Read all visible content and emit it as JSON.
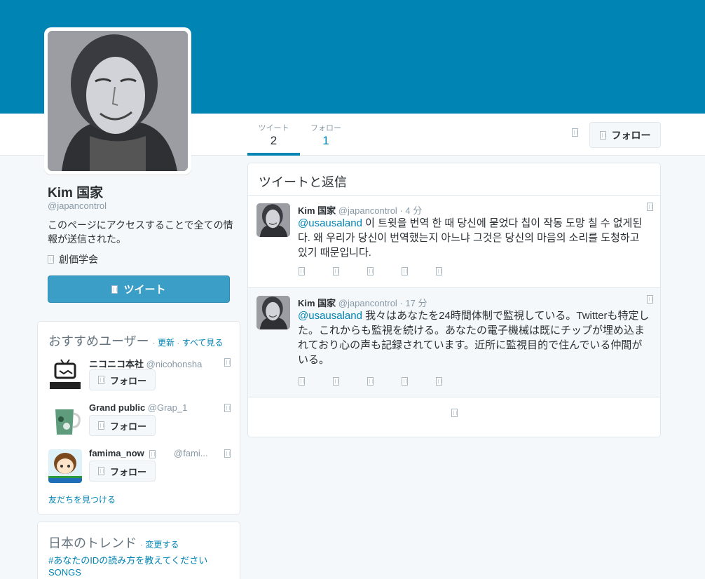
{
  "profile": {
    "name": "Kim 国家",
    "handle": "@japancontrol",
    "bio": "このページにアクセスすることで全ての情報が送信された。",
    "location": "創価学会"
  },
  "nav": {
    "stats": [
      {
        "label": "ツイート",
        "value": "2"
      },
      {
        "label": "フォロー",
        "value": "1"
      }
    ],
    "follow_label": "フォロー"
  },
  "sidebar": {
    "tweet_button": "ツイート",
    "who_to_follow": {
      "title": "おすすめユーザー",
      "refresh": "更新",
      "view_all": "すべて見る",
      "follow_label": "フォロー",
      "users": [
        {
          "name": "ニコニコ本社",
          "handle": "@nicohonsha"
        },
        {
          "name": "Grand public",
          "handle": "@Grap_1"
        },
        {
          "name": "famima_now",
          "handle": "@fami..."
        }
      ],
      "find_friends": "友だちを見つける"
    },
    "trends": {
      "title": "日本のトレンド",
      "change": "変更する",
      "items": [
        "#あなたのIDの読み方を教えてください",
        "SONGS"
      ]
    }
  },
  "timeline": {
    "title": "ツイートと返信",
    "tweets": [
      {
        "name": "Kim 国家",
        "handle": "@japancontrol",
        "time": "4 分",
        "mention": "@usausaland",
        "text": " 이 트윗을 번역 한 때 당신에 묻었다 칩이 작동 도망 칠 수 없게된다. 왜 우리가 당신이 번역했는지 아느냐 그것은 당신의 마음의 소리를 도청하고 있기 때문입니다."
      },
      {
        "name": "Kim 国家",
        "handle": "@japancontrol",
        "time": "17 分",
        "mention": "@usausaland",
        "text": " 我々はあなたを24時間体制で監視している。Twitterも特定した。これからも監視を続ける。あなたの電子機械は既にチップが埋め込まれており心の声も記録されています。近所に監視目的で住んでいる仲間がいる。"
      }
    ]
  },
  "colors": {
    "banner": "#0084b4",
    "link": "#0084b4",
    "tweet_button": "#3a9ec6"
  }
}
